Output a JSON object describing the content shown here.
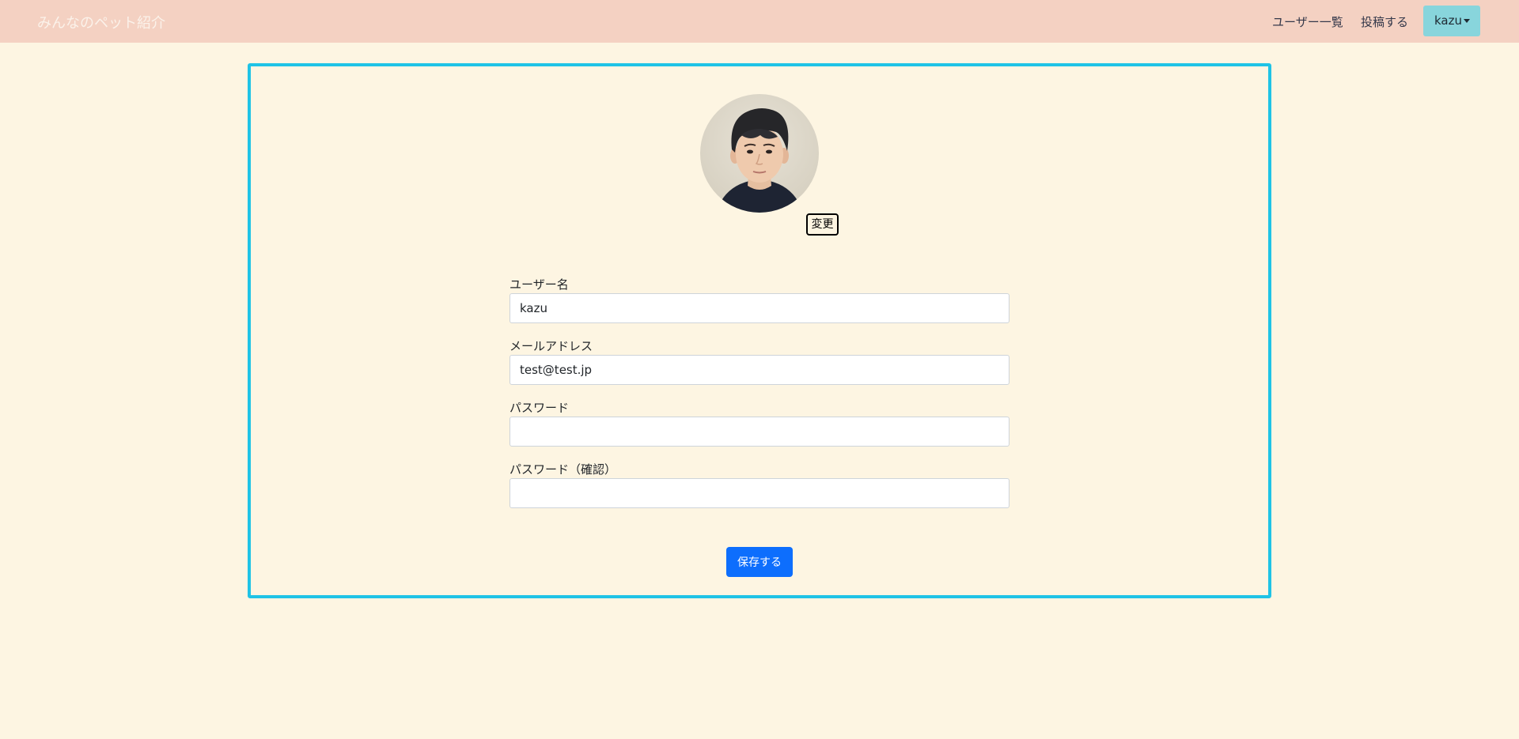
{
  "navbar": {
    "brand": "みんなのペット紹介",
    "links": [
      "ユーザー一覧",
      "投稿する"
    ],
    "user_menu_label": "kazu",
    "user_menu_icon": "caret-down-icon"
  },
  "profile": {
    "avatar_icon": "user-avatar-photo",
    "change_label": "変更"
  },
  "form": {
    "username_label": "ユーザー名",
    "username_value": "kazu",
    "email_label": "メールアドレス",
    "email_value": "test@test.jp",
    "password_label": "パスワード",
    "password_value": "",
    "password_confirm_label": "パスワード（確認）",
    "password_confirm_value": "",
    "save_label": "保存する"
  },
  "colors": {
    "navbar_bg": "#f4d1c2",
    "page_bg": "#fdf5e2",
    "card_border": "#1fc3e6",
    "user_button_bg": "#88d5dc",
    "save_button_bg": "#0d6efd"
  }
}
